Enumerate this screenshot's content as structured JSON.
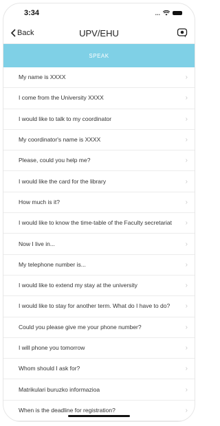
{
  "status": {
    "time": "3:34",
    "signal": "...",
    "wifi": "wifi",
    "battery": "battery"
  },
  "nav": {
    "back_label": "Back",
    "title": "UPV/EHU",
    "action_icon": "chat-icon"
  },
  "banner": {
    "label": "SPEAK",
    "color": "#7fd0e6"
  },
  "list": {
    "items": [
      {
        "label": "My name is XXXX"
      },
      {
        "label": "I come from the University XXXX"
      },
      {
        "label": "I would like to talk to my coordinator"
      },
      {
        "label": "My coordinator's name is XXXX"
      },
      {
        "label": "Please, could you help me?"
      },
      {
        "label": "I would like the card for the library"
      },
      {
        "label": "How much is it?"
      },
      {
        "label": "I would like to know the time-table of the Faculty secretariat"
      },
      {
        "label": "Now I live in..."
      },
      {
        "label": "My telephone number is..."
      },
      {
        "label": "I would like to extend my stay at the university"
      },
      {
        "label": "I would like to stay for another term. What do I have to do?"
      },
      {
        "label": "Could you please give me your phone number?"
      },
      {
        "label": "I will phone you tomorrow"
      },
      {
        "label": "Whom should I ask for?"
      },
      {
        "label": "Matrikulari buruzko informazioa"
      },
      {
        "label": "When is the deadline for registration?"
      }
    ]
  }
}
